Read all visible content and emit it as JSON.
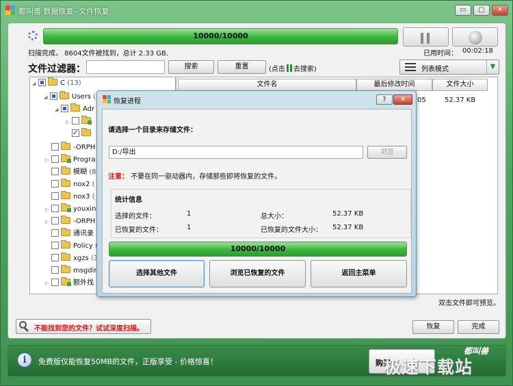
{
  "window": {
    "title": "都叫兽 数据恢复--文件恢复",
    "controls": {
      "minimize": "▭",
      "maximize": "▢",
      "close": "✕"
    },
    "colors": {
      "frame": "#52a862",
      "progress": "#38b63b",
      "close": "#c4412c"
    }
  },
  "scan": {
    "progress_text": "10000/10000",
    "progress_fraction": 1.0,
    "status": "扫描完成， 8604文件被找到，总计 2.33 GB.",
    "elapsed_label": "已用时间：",
    "elapsed_value": "00:02:18"
  },
  "filter": {
    "label": "文件过滤器：",
    "input_value": "",
    "search_button": "搜索",
    "reset_button": "重置",
    "hint_prefix": "(点击",
    "hint_suffix": "去搜索)",
    "view_mode": "列表模式"
  },
  "tree": {
    "items": [
      {
        "label": "C",
        "count": "(13)"
      },
      {
        "label": "Users",
        "count": "("
      },
      {
        "label": "Adr",
        "count": ""
      },
      {
        "label": "",
        "count": ""
      },
      {
        "label": "",
        "count": ""
      },
      {
        "label": "-ORPH",
        "count": ""
      },
      {
        "label": "Progra",
        "count": ""
      },
      {
        "label": "模糊",
        "count": "(8"
      },
      {
        "label": "nox2",
        "count": "("
      },
      {
        "label": "nox3",
        "count": "("
      },
      {
        "label": "youxin",
        "count": ""
      },
      {
        "label": "-ORPH",
        "count": ""
      },
      {
        "label": "通讯录",
        "count": ""
      },
      {
        "label": "Policy",
        "count": "("
      },
      {
        "label": "xgzs",
        "count": "(3"
      },
      {
        "label": "msgdir",
        "count": ""
      },
      {
        "label": "额外找",
        "count": ""
      }
    ]
  },
  "filelist": {
    "columns": {
      "name": "文件名",
      "modified": "最后修改时间",
      "size": "文件大小"
    },
    "rows": [
      {
        "modified": "05",
        "size": "52.37 KB"
      }
    ],
    "hint": "双击文件即可预览。"
  },
  "actions": {
    "deep_scan": "不能找到您的文件？试试深度扫描。",
    "recover": "恢复",
    "finish": "完成"
  },
  "footer": {
    "info": "免费版仅能恢复50MB的文件，正版享受 - 价格惊喜！",
    "buy_button": "购买",
    "brand": "都叫兽"
  },
  "watermark": "极速下载站",
  "dialog": {
    "title": "恢复进程",
    "help": "?",
    "close": "✕",
    "prompt": "请选择一个目录来存储文件：",
    "path_value": "D:/导出",
    "browse_button": "浏览",
    "note_label": "注意：",
    "note_text": "不要在同一驱动器内，存储那些即将恢复的文件。",
    "stats_title": "统计信息",
    "stats": {
      "selected_label": "选择的文件：",
      "selected_value": "1",
      "total_size_label": "总大小：",
      "total_size_value": "52.37 KB",
      "recovered_label": "已恢复的文件：",
      "recovered_value": "1",
      "recovered_size_label": "已恢复的文件大小：",
      "recovered_size_value": "52.37 KB"
    },
    "progress_text": "10000/10000",
    "progress_fraction": 1.0,
    "buttons": {
      "other": "选择其他文件",
      "browse_recovered": "浏览已恢复的文件",
      "main_menu": "返回主菜单"
    }
  }
}
